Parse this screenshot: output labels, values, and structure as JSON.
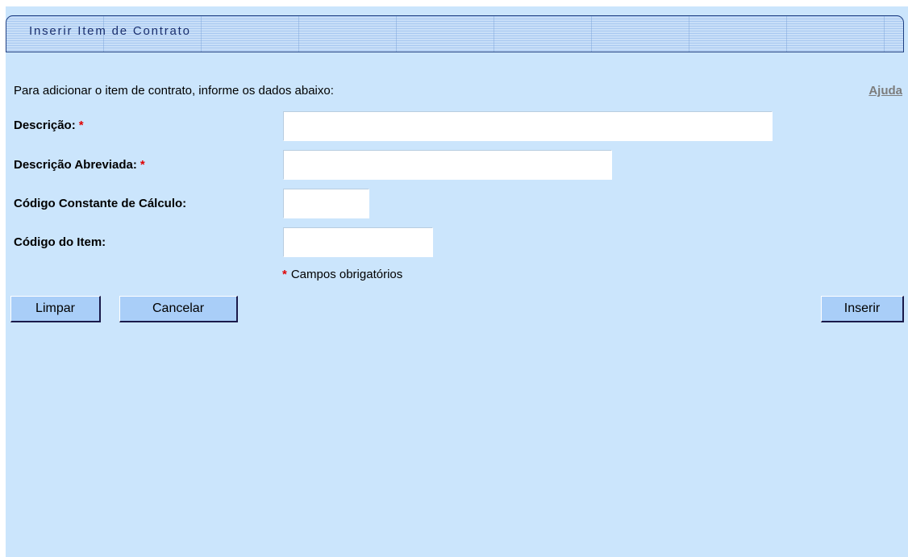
{
  "header": {
    "title": "Inserir Item de Contrato"
  },
  "intro_text": "Para adicionar o item de contrato, informe os dados abaixo:",
  "help_link": "Ajuda",
  "form": {
    "descricao": {
      "label": "Descrição:",
      "required_mark": "*",
      "value": ""
    },
    "descricao_abreviada": {
      "label": "Descrição Abreviada:",
      "required_mark": "*",
      "value": ""
    },
    "codigo_constante": {
      "label": "Código Constante de Cálculo:",
      "value": ""
    },
    "codigo_item": {
      "label": "Código do Item:",
      "value": ""
    }
  },
  "required_note": {
    "mark": "*",
    "text": "Campos obrigatórios"
  },
  "buttons": {
    "limpar": "Limpar",
    "cancelar": "Cancelar",
    "inserir": "Inserir"
  },
  "colors": {
    "background": "#cbe5fc",
    "button": "#a9cef8",
    "required": "#e00000",
    "title_text": "#1a2f6e"
  }
}
